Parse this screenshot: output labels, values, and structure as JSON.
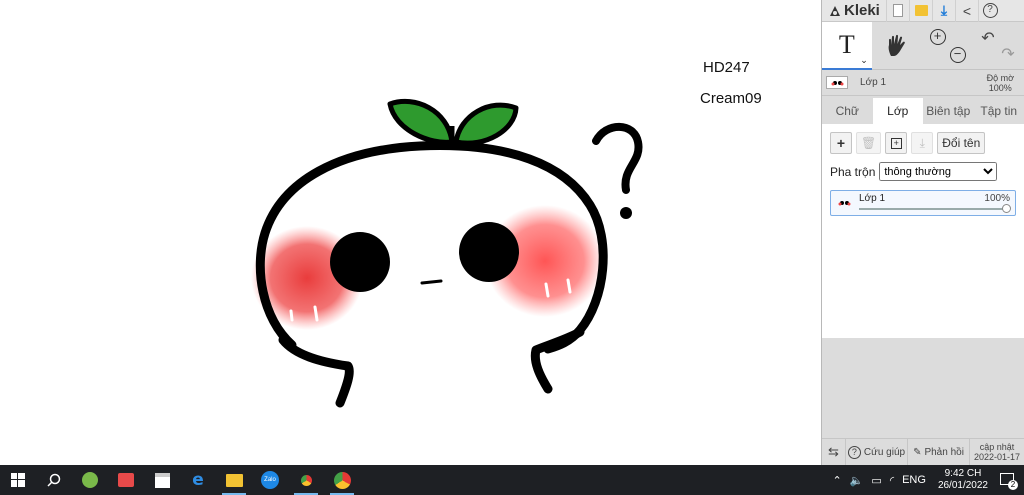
{
  "canvas": {
    "text1": "HD247",
    "text2": "Cream09"
  },
  "app": {
    "name": "Kleki",
    "layer_name": "Lớp 1",
    "opacity_label": "Độ mờ",
    "opacity_value": "100%"
  },
  "tabs": [
    {
      "label": "Chữ"
    },
    {
      "label": "Lớp"
    },
    {
      "label": "Biên tập"
    },
    {
      "label": "Tập tin"
    }
  ],
  "layers_panel": {
    "rename_label": "Đổi tên",
    "blend_label": "Pha trộn",
    "blend_value": "thông thường",
    "layer_name": "Lớp 1",
    "layer_opacity": "100%",
    "layer_opacity_value": 1.0
  },
  "bottom": {
    "help": "Cứu giúp",
    "feedback": "Phản hồi",
    "update_label": "cập nhật",
    "update_date": "2022-01-17"
  },
  "taskbar": {
    "lang": "ENG",
    "time": "9:42 CH",
    "date": "26/01/2022",
    "notif_count": "2",
    "zalo_label": "Zalo"
  },
  "colors": {
    "accent": "#3a7bd5",
    "leaf": "#2e9a2e",
    "blush": "#ee3c3c"
  }
}
